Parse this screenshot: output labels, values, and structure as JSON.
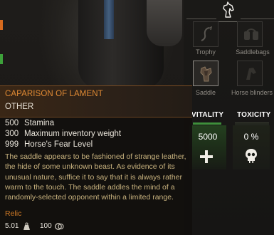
{
  "item": {
    "name": "CAPARISON OF LAMENT",
    "type": "OTHER",
    "attributes": [
      {
        "value": "500",
        "label": "Stamina"
      },
      {
        "value": "300",
        "label": "Maximum inventory weight"
      },
      {
        "value": "999",
        "label": "Horse's Fear Level"
      }
    ],
    "description": "The saddle appears to be fashioned of strange leather, the hide of some unknown beast. As evidence of its unusual nature, suffice it to say that it is always rather warm to the touch. The saddle addles the mind of a randomly-selected opponent within a limited range.",
    "rarity": "Relic",
    "weight": "5.01",
    "price": "100"
  },
  "equipment_slots": [
    {
      "label": "Trophy",
      "icon": "trophy-icon",
      "filled": false
    },
    {
      "label": "Saddlebags",
      "icon": "saddlebags-icon",
      "filled": false
    },
    {
      "label": "Saddle",
      "icon": "saddle-icon",
      "filled": true
    },
    {
      "label": "Horse blinders",
      "icon": "blinders-icon",
      "filled": false
    }
  ],
  "stats": {
    "vitality": {
      "label": "VITALITY",
      "value": "5000",
      "icon": "plus-icon"
    },
    "toxicity": {
      "label": "TOXICITY",
      "value": "0 %",
      "icon": "skull-icon"
    }
  },
  "colors": {
    "rarity_orange": "#e08a34",
    "description_gold": "#c9b37f",
    "vitality_green": "#3e8f3b"
  },
  "header_icon": "horse-head-icon"
}
